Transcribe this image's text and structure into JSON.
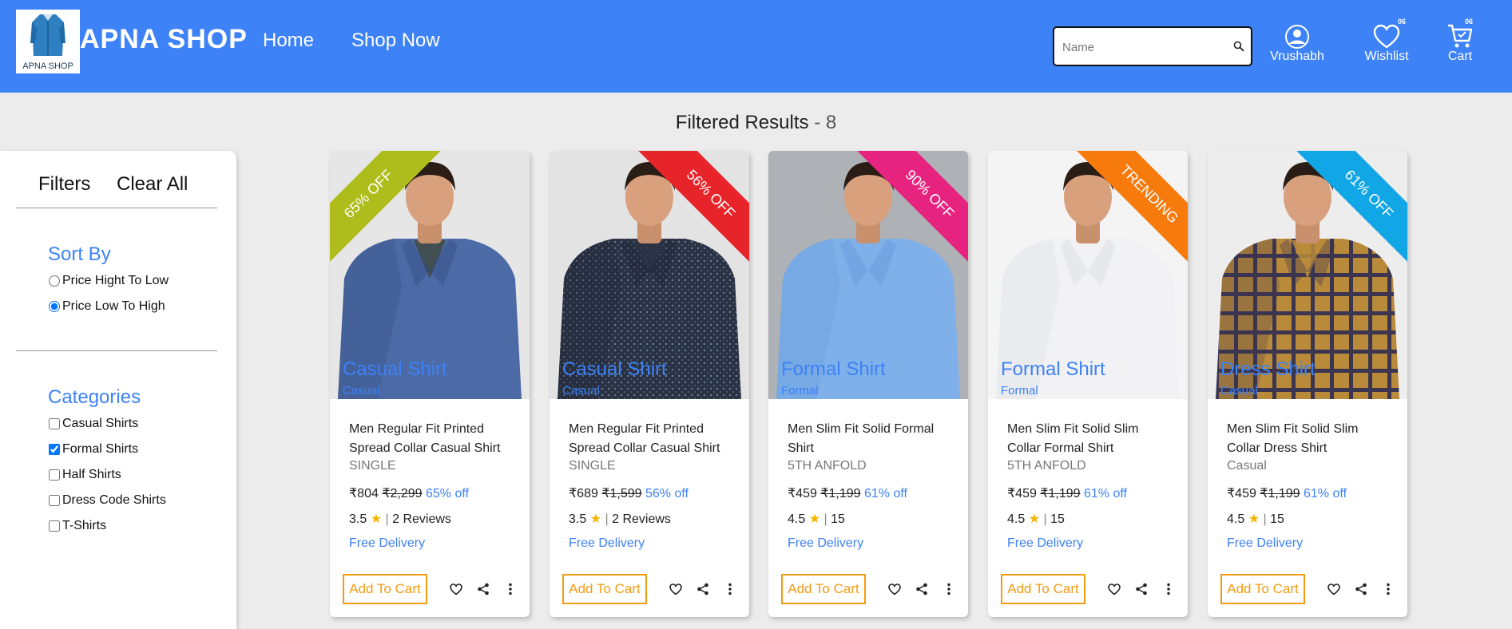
{
  "header": {
    "brand": "APNA SHOP",
    "logo_text": "APNA SHOP",
    "nav": [
      "Home",
      "Shop Now"
    ],
    "search_placeholder": "Name",
    "user_label": "Vrushabh",
    "wishlist_label": "Wishlist",
    "wishlist_count": "06",
    "cart_label": "Cart",
    "cart_count": "06"
  },
  "results": {
    "label": "Filtered Results",
    "separator": "-",
    "count": "8"
  },
  "sidebar": {
    "filters_label": "Filters",
    "clear_label": "Clear All",
    "sort_title": "Sort By",
    "sort_options": [
      {
        "label": "Price Hight To Low",
        "checked": false
      },
      {
        "label": "Price Low To High",
        "checked": true
      }
    ],
    "categories_title": "Categories",
    "categories": [
      {
        "label": "Casual Shirts",
        "checked": false
      },
      {
        "label": "Formal Shirts",
        "checked": true
      },
      {
        "label": "Half Shirts",
        "checked": false
      },
      {
        "label": "Dress Code Shirts",
        "checked": false
      },
      {
        "label": "T-Shirts",
        "checked": false
      }
    ]
  },
  "products": [
    {
      "ribbon": "65% OFF",
      "ribbon_color": "#aebd1c",
      "ribbon_side": "left",
      "overlay_category": "Casual Shirt",
      "overlay_sub": "Casual",
      "name": "Men Regular Fit Printed Spread Collar Casual Shirt",
      "seller": "SINGLE",
      "price": "₹804",
      "mrp": "₹2,299",
      "discount": "65% off",
      "rating": "3.5",
      "reviews": "2 Reviews",
      "delivery": "Free Delivery",
      "add_label": "Add To Cart",
      "bg": "#e6e6e6",
      "shirt_color": "#4c6aa6",
      "shirt_dark": "#2f4677",
      "inner_color": "#3f4a44",
      "pattern": "solid"
    },
    {
      "ribbon": "56% OFF",
      "ribbon_color": "#e8242b",
      "ribbon_side": "right",
      "overlay_category": "Casual Shirt",
      "overlay_sub": "Casual",
      "name": "Men Regular Fit Printed Spread Collar Casual Shirt",
      "seller": "SINGLE",
      "price": "₹689",
      "mrp": "₹1,599",
      "discount": "56% off",
      "rating": "3.5",
      "reviews": "2 Reviews",
      "delivery": "Free Delivery",
      "add_label": "Add To Cart",
      "bg": "#e3e3e3",
      "shirt_color": "#2a3344",
      "shirt_dark": "#1a2030",
      "inner_color": "#2a3344",
      "pattern": "dots"
    },
    {
      "ribbon": "90% OFF",
      "ribbon_color": "#e6247f",
      "ribbon_side": "right",
      "overlay_category": "Formal Shirt",
      "overlay_sub": "Formal",
      "name": "Men Slim Fit Solid Formal Shirt",
      "seller": "5TH ANFOLD",
      "price": "₹459",
      "mrp": "₹1,199",
      "discount": "61% off",
      "rating": "4.5",
      "reviews": "15",
      "delivery": "Free Delivery",
      "add_label": "Add To Cart",
      "bg": "#aeb1b5",
      "shirt_color": "#7fb0ea",
      "shirt_dark": "#5e93d6",
      "inner_color": "#7fb0ea",
      "pattern": "solid"
    },
    {
      "ribbon": "TRENDING",
      "ribbon_color": "#f77a0c",
      "ribbon_side": "right",
      "overlay_category": "Formal Shirt",
      "overlay_sub": "Formal",
      "name": "Men Slim Fit Solid Slim Collar Formal Shirt",
      "seller": "5TH ANFOLD",
      "price": "₹459",
      "mrp": "₹1,199",
      "discount": "61% off",
      "rating": "4.5",
      "reviews": "15",
      "delivery": "Free Delivery",
      "add_label": "Add To Cart",
      "bg": "#f4f4f4",
      "shirt_color": "#f2f2f4",
      "shirt_dark": "#d5d6dc",
      "inner_color": "#f2f2f4",
      "pattern": "solid"
    },
    {
      "ribbon": "61% OFF",
      "ribbon_color": "#11a6e6",
      "ribbon_side": "right",
      "overlay_category": "Dress Shirt",
      "overlay_sub": "Casual",
      "name": "Men Slim Fit Solid Slim Collar Dress Shirt",
      "seller": "Casual",
      "price": "₹459",
      "mrp": "₹1,199",
      "discount": "61% off",
      "rating": "4.5",
      "reviews": "15",
      "delivery": "Free Delivery",
      "add_label": "Add To Cart",
      "bg": "#ededed",
      "shirt_color": "#b88a3a",
      "shirt_dark": "#3b3550",
      "inner_color": "#b88a3a",
      "pattern": "check"
    }
  ]
}
